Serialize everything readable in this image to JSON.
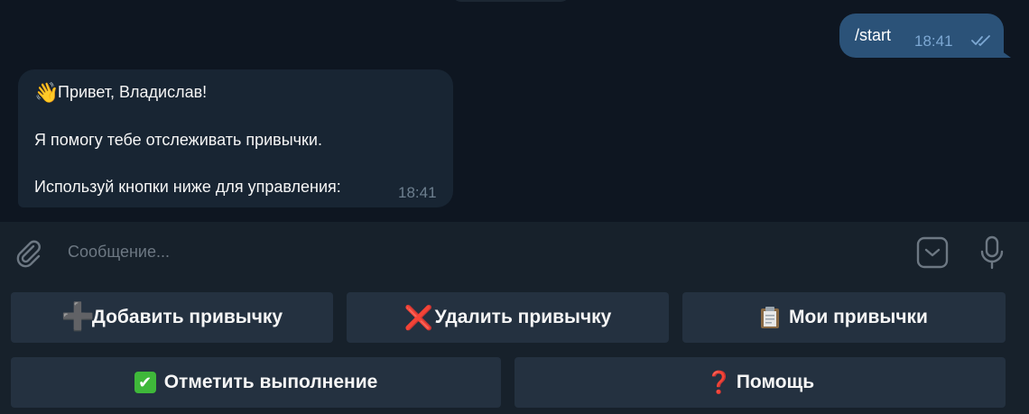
{
  "chat": {
    "outgoing": {
      "text": "/start",
      "time": "18:41",
      "status_icon": "double-check-icon"
    },
    "incoming": {
      "greeting_icon": "👋",
      "greeting": "Привет, Владислав!",
      "line2": "Я помогу тебе отслеживать привычки.",
      "line3": "Используй кнопки ниже для управления:",
      "time": "18:41"
    }
  },
  "composer": {
    "placeholder": "Сообщение...",
    "attach_icon": "paperclip-icon",
    "keyboard_toggle_icon": "keyboard-toggle-icon",
    "mic_icon": "microphone-icon"
  },
  "keyboard": {
    "row1": [
      {
        "icon": "➕",
        "label": "Добавить привычку"
      },
      {
        "icon": "❌",
        "label": "Удалить привычку"
      },
      {
        "icon": "📋",
        "label": "Мои привычки"
      }
    ],
    "row2": [
      {
        "icon": "✔",
        "label": "Отметить выполнение"
      },
      {
        "icon": "❓",
        "label": "Помощь"
      }
    ]
  },
  "colors": {
    "chat_bg": "#0e1621",
    "outgoing_bubble": "#2b5278",
    "incoming_bubble": "#182533",
    "panel_bg": "#17212b",
    "button_bg": "#243140"
  }
}
